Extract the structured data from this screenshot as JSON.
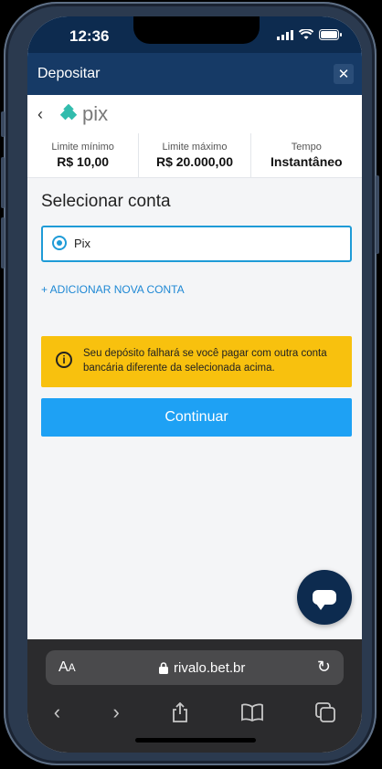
{
  "status_bar": {
    "time": "12:36"
  },
  "header": {
    "title": "Depositar",
    "close": "✕"
  },
  "payment_method": {
    "logo_text": "pix"
  },
  "limits": [
    {
      "label": "Limite mínimo",
      "value": "R$ 10,00"
    },
    {
      "label": "Limite máximo",
      "value": "R$ 20.000,00"
    },
    {
      "label": "Tempo",
      "value": "Instantâneo"
    }
  ],
  "section_title": "Selecionar conta",
  "account": {
    "label": "Pix",
    "selected": true
  },
  "add_account_label": "+ ADICIONAR NOVA CONTA",
  "warning": {
    "text": "Seu depósito falhará se você pagar com outra conta bancária diferente da selecionada acima."
  },
  "continue_label": "Continuar",
  "browser": {
    "url": "rivalo.bet.br",
    "aa_big": "A",
    "aa_small": "A"
  },
  "colors": {
    "header": "#163a66",
    "accent": "#1ea1f4",
    "warning": "#f8c10e"
  }
}
